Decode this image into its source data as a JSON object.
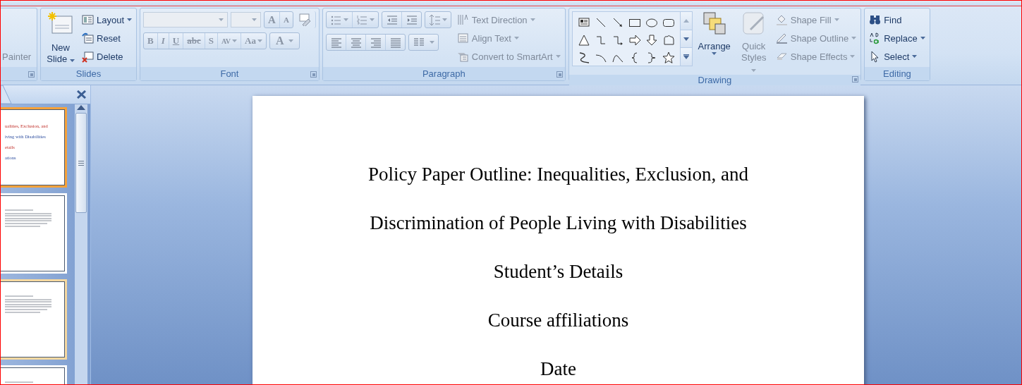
{
  "ribbon": {
    "clipboard_group": {
      "painter": {
        "label": "Painter",
        "disabled": true
      }
    },
    "slides_group": {
      "label": "Slides",
      "new_slide": {
        "label": "New Slide",
        "dropdown": true
      },
      "commands": [
        {
          "kind": "layout",
          "label": "Layout",
          "dropdown": true
        },
        {
          "kind": "reset",
          "label": "Reset",
          "dropdown": false
        },
        {
          "kind": "delete",
          "label": "Delete",
          "dropdown": false
        }
      ]
    },
    "font_group": {
      "label": "Font",
      "disabled": true,
      "size_buttons": [
        {
          "label": "A",
          "kind": "grow"
        },
        {
          "label": "A",
          "kind": "shrink"
        }
      ],
      "format_buttons": [
        {
          "label": "B",
          "kind": "bold",
          "dropdown": false
        },
        {
          "label": "I",
          "kind": "italic",
          "dropdown": false
        },
        {
          "label": "U",
          "kind": "underline",
          "dropdown": false
        },
        {
          "label": "abc",
          "kind": "strike",
          "dropdown": false
        },
        {
          "label": "S",
          "kind": "shadow",
          "dropdown": false
        },
        {
          "label": "AV",
          "kind": "spacing",
          "dropdown": true
        },
        {
          "label": "Aa",
          "kind": "case",
          "dropdown": true
        }
      ],
      "color_button": {
        "label": "A",
        "dropdown": true
      }
    },
    "paragraph_group": {
      "label": "Paragraph",
      "commands": [
        {
          "kind": "direction",
          "label": "Text Direction",
          "disabled": true
        },
        {
          "kind": "align",
          "label": "Align Text",
          "disabled": true
        },
        {
          "kind": "smartart",
          "label": "Convert to SmartArt",
          "disabled": true
        }
      ]
    },
    "drawing_group": {
      "label": "Drawing",
      "arrange": {
        "label": "Arrange",
        "disabled": false
      },
      "quick_styles": {
        "label": "Quick Styles",
        "disabled": true
      },
      "commands": [
        {
          "kind": "fill",
          "label": "Shape Fill",
          "disabled": true
        },
        {
          "kind": "outline",
          "label": "Shape Outline",
          "disabled": true
        },
        {
          "kind": "effects",
          "label": "Shape Effects",
          "disabled": true
        }
      ]
    },
    "editing_group": {
      "label": "Editing",
      "commands": [
        {
          "kind": "find",
          "label": "Find",
          "dropdown": false
        },
        {
          "kind": "replace",
          "label": "Replace",
          "dropdown": true
        },
        {
          "kind": "select",
          "label": "Select",
          "dropdown": true
        }
      ]
    }
  },
  "slide_panel": {
    "thumbnails": [
      {
        "selected": true,
        "highlighted": false,
        "lines": [
          "ualities, Exclusion, and",
          "iving with Disabilities",
          "etails",
          "ations"
        ]
      },
      {
        "selected": false,
        "highlighted": false
      },
      {
        "selected": false,
        "highlighted": true
      },
      {
        "selected": false,
        "highlighted": false
      }
    ]
  },
  "slide": {
    "lines": [
      "Policy Paper Outline: Inequalities, Exclusion, and",
      "Discrimination of People Living with Disabilities",
      "Student’s Details",
      "Course affiliations",
      "Date"
    ]
  }
}
